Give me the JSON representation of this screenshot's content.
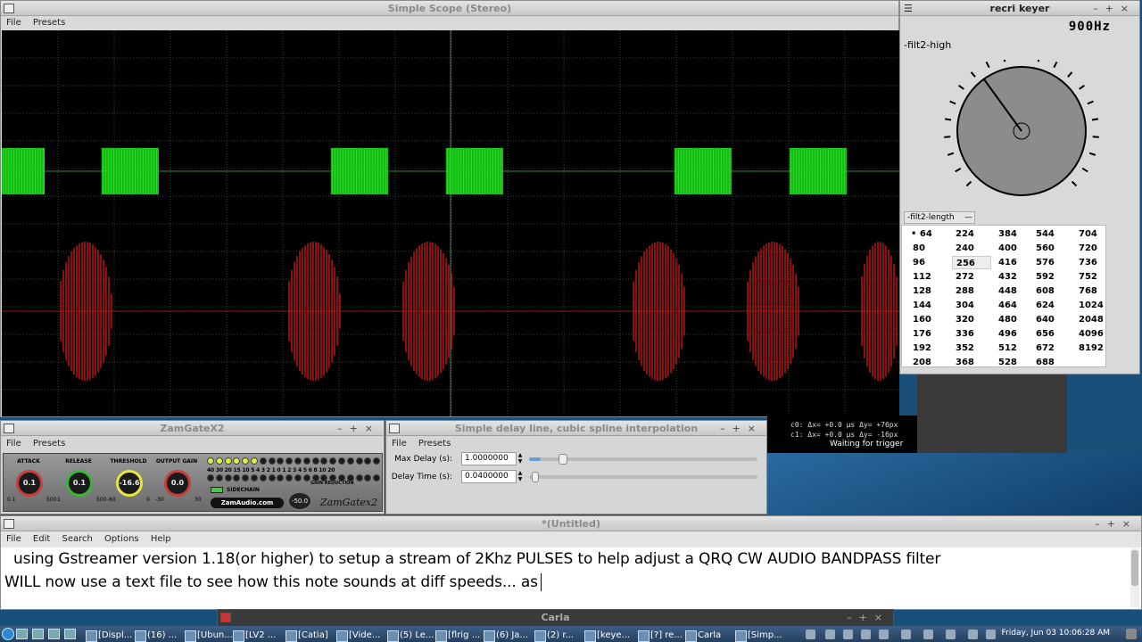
{
  "scope_window": {
    "title": "Simple Scope (Stereo)",
    "menu": [
      "File",
      "Presets"
    ],
    "cursor_line1": "c0: Δx=  +0.0 µs Δy= +76px",
    "cursor_line2": "c1: Δx=  +0.0 µs Δy=  -16px",
    "trigger_status": "Waiting for trigger"
  },
  "keyer_window": {
    "title": "recri keyer",
    "freq": "900Hz",
    "param_label": "-filt2-high",
    "length_label": "-filt2-length",
    "selected_value": "64",
    "hovered_value": "256",
    "length_columns": [
      [
        "64",
        "80",
        "96",
        "112",
        "128",
        "144",
        "160",
        "176",
        "192",
        "208"
      ],
      [
        "224",
        "240",
        "256",
        "272",
        "288",
        "304",
        "320",
        "336",
        "352",
        "368"
      ],
      [
        "384",
        "400",
        "416",
        "432",
        "448",
        "464",
        "480",
        "496",
        "512",
        "528"
      ],
      [
        "544",
        "560",
        "576",
        "592",
        "608",
        "624",
        "640",
        "656",
        "672",
        "688"
      ],
      [
        "704",
        "720",
        "736",
        "752",
        "768",
        "1024",
        "2048",
        "4096",
        "8192"
      ]
    ]
  },
  "zamgate": {
    "title": "ZamGateX2",
    "menu": [
      "File",
      "Presets"
    ],
    "knobs": [
      {
        "label": "ATTACK",
        "value": "0.1",
        "min": "0.1",
        "max": "500",
        "color": "#c83c3c"
      },
      {
        "label": "RELEASE",
        "value": "0.1",
        "min": "1",
        "max": "500",
        "color": "#3cb43c"
      },
      {
        "label": "THRESHOLD",
        "value": "-16.6",
        "min": "-60",
        "max": "0",
        "color": "#e8e83c"
      },
      {
        "label": "OUTPUT GAIN",
        "value": "0.0",
        "min": "-30",
        "max": "30",
        "color": "#c83c3c"
      }
    ],
    "meter_scale": "40 30 20 15 10 5 4 3 2 1 0 1 2 3 4 5 6 8 10 20",
    "gain_reduction": "GAIN REDUCTION",
    "sidechain": "SIDECHAIN",
    "brand": "ZamAudio.com",
    "dial_value": "-50.0",
    "logo": "ZamGatex2"
  },
  "delay": {
    "title": "Simple delay line, cubic spline interpolation",
    "menu": [
      "File",
      "Presets"
    ],
    "max_delay_label": "Max Delay (s):",
    "max_delay_value": "1.0000000",
    "max_delay_frac": 0.05,
    "delay_time_label": "Delay Time (s):",
    "delay_time_value": "0.0400000",
    "delay_time_frac": 0.01
  },
  "editor": {
    "title": "*(Untitled)",
    "menu": [
      "File",
      "Edit",
      "Search",
      "Options",
      "Help"
    ],
    "line1": "using Gstreamer version 1.18(or higher)  to setup a stream of 2Khz PULSES   to help adjust a QRQ CW AUDIO BANDPASS filter",
    "line2": "WILL now use a text file to see how this note sounds at diff speeds... as"
  },
  "carla": {
    "title": "Carla"
  },
  "taskbar": {
    "items": [
      "[Displ...",
      "(16) ...",
      "[Ubun...",
      "[LV2 ...",
      "[Catia]",
      "[Vide...",
      "(5) Le...",
      "[flrig ...",
      "(6) Ja...",
      "(2) r...",
      "[keye...",
      "[?] re...",
      "Carla",
      "[Simp..."
    ],
    "clock": "Friday, Jun 03 10:06:28 AM"
  },
  "colors": {
    "green_trace": "#22ee22",
    "red_trace": "#c81414",
    "grid": "#2f4a2f"
  }
}
